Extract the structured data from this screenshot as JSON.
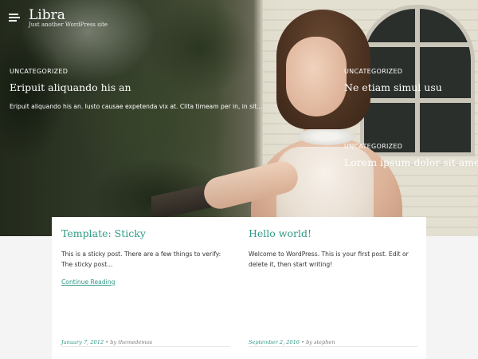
{
  "site": {
    "title": "Libra",
    "description": "Just another WordPress site"
  },
  "featured": [
    {
      "category": "UNCATEGORIZED",
      "title": "Eripuit aliquando his an",
      "excerpt": "Eripuit aliquando his an. Iusto causae expetenda vix at. Clita timeam per in, in sit..."
    },
    {
      "category": "UNCATEGORIZED",
      "title": "Ne etiam simul usu"
    },
    {
      "category": "UNCATEGORIZED",
      "title": "Lorem ipsum dolor sit amet"
    }
  ],
  "posts": [
    {
      "title": "Template: Sticky",
      "excerpt": "This is a sticky post. There are a few things to verify: The sticky post...",
      "read_more": "Continue Reading",
      "date": "January 7, 2012",
      "author": "by themedemos"
    },
    {
      "title": "Hello world!",
      "excerpt": "Welcome to WordPress. This is your first post. Edit or delete it, then start writing!",
      "date": "September 2, 2016",
      "author": "by stephen"
    }
  ],
  "meta_separator": " • ",
  "colors": {
    "accent": "#2f9a87",
    "card_bg": "#ffffff",
    "page_bg": "#f4f4f4"
  }
}
